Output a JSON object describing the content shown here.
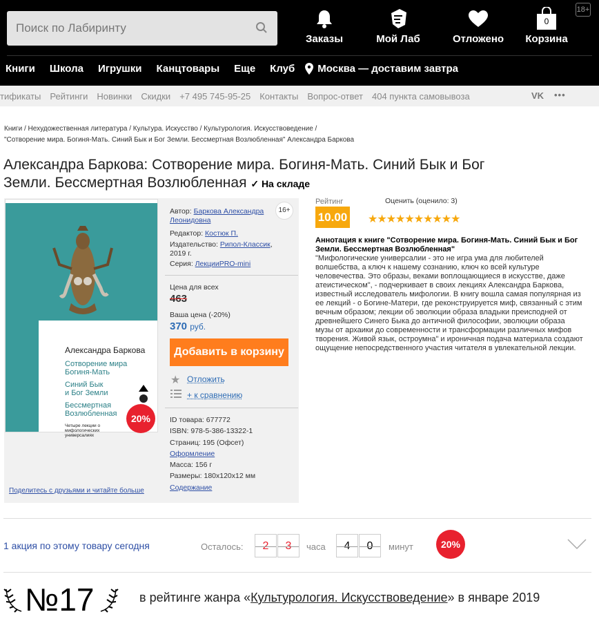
{
  "header": {
    "search_placeholder": "Поиск по Лабиринту",
    "icons": [
      {
        "name": "bell-icon",
        "label": "Заказы"
      },
      {
        "name": "profile-icon",
        "label": "Мой Лаб"
      },
      {
        "name": "heart-icon",
        "label": "Отложено"
      },
      {
        "name": "bag-icon",
        "label": "Корзина",
        "count": "0"
      }
    ],
    "age_badge": "18+"
  },
  "nav": {
    "items": [
      "Книги",
      "Школа",
      "Игрушки",
      "Канцтовары",
      "Еще",
      "Клуб"
    ],
    "location": "Москва — доставим завтра"
  },
  "subnav": {
    "items": [
      "тификаты",
      "Рейтинги",
      "Новинки",
      "Скидки",
      "+7 495 745-95-25",
      "Контакты",
      "Вопрос-ответ",
      "404 пункта самовывоза"
    ],
    "vk": "VK",
    "more": "•••"
  },
  "breadcrumbs": {
    "line1": "Книги / Нехудожественная литература / Культура. Искусство / Культурология. Искусствоведение /",
    "line2": "\"Сотворение мира. Богиня-Мать. Синий Бык и Бог Земли. Бессмертная Возлюбленная\" Александра Баркова"
  },
  "product": {
    "title_line1": "Александра Баркова: Сотворение мира. Богиня-Мать. Синий Бык и Бог",
    "title_line2": "Земли. Бессмертная Возлюбленная",
    "stock": "На складе",
    "cover": {
      "author": "Александра Баркова",
      "title_lines": [
        "Сотворение мира",
        "Богиня-Мать",
        "Синий Бык",
        "и Бог Земли",
        "Бессмертная",
        "Возлюбленная"
      ],
      "subtitle": "Четыре лекции о мифологических универсалиях"
    },
    "age": "16+",
    "author_label": "Автор:",
    "author": "Баркова Александра Леонидовна",
    "editor_label": "Редактор:",
    "editor": "Костюк П.",
    "publisher_label": "Издательство:",
    "publisher": "Рипол-Классик",
    "year": ", 2019 г.",
    "series_label": "Серия:",
    "series": "ЛекцииPRO-mini",
    "price_all_label": "Цена для всех",
    "price_old": "463",
    "your_price_label": "Ваша цена (-20%)",
    "price_new": "370",
    "currency": "руб.",
    "cart_button": "Добавить в корзину",
    "postpone": "Отложить",
    "compare": "+ к сравнению",
    "discount": "20%",
    "id_label": "ID товара:",
    "id": "677772",
    "isbn_label": "ISBN:",
    "isbn": "978-5-386-13322-1",
    "pages_label": "Страниц:",
    "pages": "195 (Офсет)",
    "design": "Оформление",
    "weight_label": "Масса:",
    "weight": "156 г",
    "size_label": "Размеры:",
    "size": "180x120x12 мм",
    "contents": "Содержание",
    "share": "Поделитесь с друзьями и читайте больше"
  },
  "rating": {
    "label": "Рейтинг",
    "value": "10.00",
    "rate_note": "Оценить (оценило: 3)",
    "stars": 10
  },
  "annotation": {
    "heading": "Аннотация к книге \"Сотворение мира. Богиня-Мать. Синий Бык и Бог Земли. Бессмертная Возлюбленная\"",
    "text": "\"Мифологические универсалии - это не игра ума для любителей волшебства, а ключ к нашему сознанию, ключ ко всей культуре человечества. Это образы, веками воплощающиеся в искусстве, даже атеистическом\", - подчеркивает в своих лекциях Александра Баркова, известный исследователь мифологии. В книгу вошла самая популярная из ее лекций - о Богине-Матери, где реконструируется миф, связанный с этим вечным образом; лекции об эволюции образа владыки преисподней от древнейшего Синего Быка до античной философии, эволюции образа музы от архаики до современности и трансформации различных мифов творения. Живой язык, остроумна\" и ироничная подача материала создают ощущение непосредственного участия читателя в увлекательной лекции."
  },
  "promo": {
    "text": "1 акция по этому товару сегодня",
    "left_label": "Осталось:",
    "hours_digits": [
      "2",
      "3"
    ],
    "hours_unit": "часа",
    "minutes_digits": [
      "4",
      "0"
    ],
    "minutes_unit": "минут",
    "discount": "20%"
  },
  "rank": {
    "number": "№17",
    "text_before": "в рейтинге жанра «",
    "genre": "Культурология. Искусствоведение",
    "text_after": "» в январе 2019"
  },
  "colors": {
    "accent": "#ff7d1d",
    "link": "#2d4ea5",
    "sale": "#e8212e",
    "star": "#f7a80d"
  }
}
